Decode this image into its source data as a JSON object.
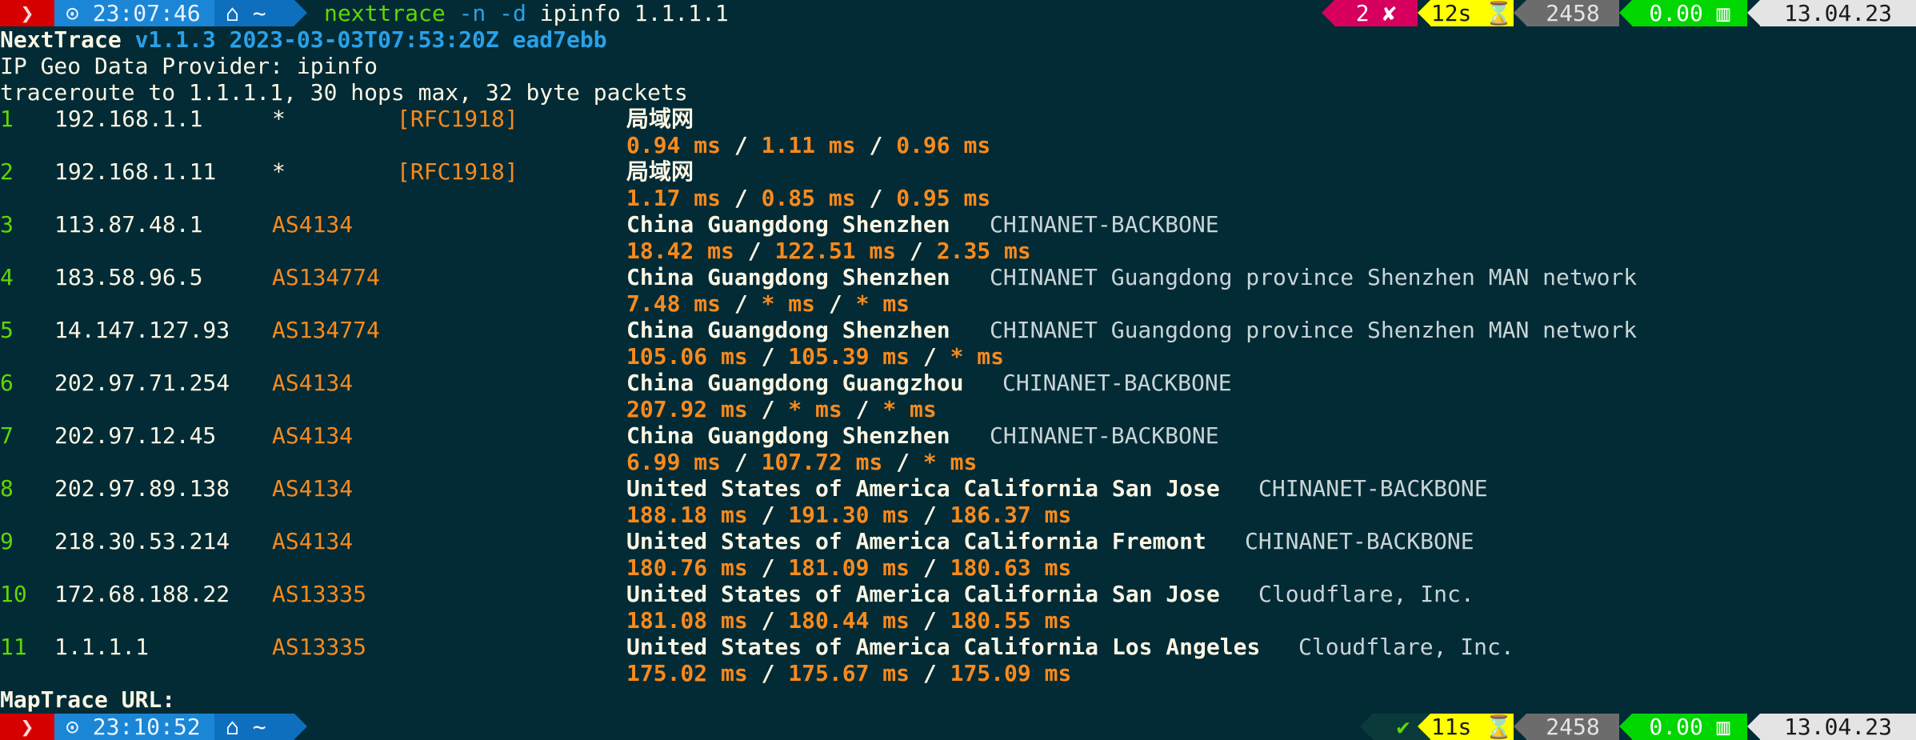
{
  "top_prompt": {
    "os_glyph": "❯",
    "time": "⊙ 23:07:46",
    "dir": "⌂ ~",
    "command": "nexttrace",
    "flags": "-n -d",
    "args": "ipinfo 1.1.1.1",
    "status": "2 ✘",
    "duration": "12s ⌛",
    "history": "2458",
    "load": "0.00 ▥",
    "date": "13.04.23"
  },
  "output": {
    "app_name": "NextTrace",
    "version_info": "v1.1.3 2023-03-03T07:53:20Z ead7ebb",
    "provider_line": "IP Geo Data Provider: ipinfo",
    "trace_line": "traceroute to 1.1.1.1, 30 hops max, 32 byte packets",
    "hops": [
      {
        "n": "1",
        "ip": "192.168.1.1",
        "asn": "*",
        "tag": "[RFC1918]",
        "geo": "局域网",
        "owner": "",
        "rtt1": "0.94 ms",
        "rtt2": "1.11 ms",
        "rtt3": "0.96 ms"
      },
      {
        "n": "2",
        "ip": "192.168.1.11",
        "asn": "*",
        "tag": "[RFC1918]",
        "geo": "局域网",
        "owner": "",
        "rtt1": "1.17 ms",
        "rtt2": "0.85 ms",
        "rtt3": "0.95 ms"
      },
      {
        "n": "3",
        "ip": "113.87.48.1",
        "asn": "AS4134",
        "tag": "",
        "geo": "China Guangdong Shenzhen",
        "owner": "CHINANET-BACKBONE",
        "rtt1": "18.42 ms",
        "rtt2": "122.51 ms",
        "rtt3": "2.35 ms"
      },
      {
        "n": "4",
        "ip": "183.58.96.5",
        "asn": "AS134774",
        "tag": "",
        "geo": "China Guangdong Shenzhen",
        "owner": "CHINANET Guangdong province Shenzhen MAN network",
        "rtt1": "7.48 ms",
        "rtt2": "* ms",
        "rtt3": "* ms"
      },
      {
        "n": "5",
        "ip": "14.147.127.93",
        "asn": "AS134774",
        "tag": "",
        "geo": "China Guangdong Shenzhen",
        "owner": "CHINANET Guangdong province Shenzhen MAN network",
        "rtt1": "105.06 ms",
        "rtt2": "105.39 ms",
        "rtt3": "* ms"
      },
      {
        "n": "6",
        "ip": "202.97.71.254",
        "asn": "AS4134",
        "tag": "",
        "geo": "China Guangdong Guangzhou",
        "owner": "CHINANET-BACKBONE",
        "rtt1": "207.92 ms",
        "rtt2": "* ms",
        "rtt3": "* ms"
      },
      {
        "n": "7",
        "ip": "202.97.12.45",
        "asn": "AS4134",
        "tag": "",
        "geo": "China Guangdong Shenzhen",
        "owner": "CHINANET-BACKBONE",
        "rtt1": "6.99 ms",
        "rtt2": "107.72 ms",
        "rtt3": "* ms"
      },
      {
        "n": "8",
        "ip": "202.97.89.138",
        "asn": "AS4134",
        "tag": "",
        "geo": "United States of America California San Jose",
        "owner": "CHINANET-BACKBONE",
        "rtt1": "188.18 ms",
        "rtt2": "191.30 ms",
        "rtt3": "186.37 ms"
      },
      {
        "n": "9",
        "ip": "218.30.53.214",
        "asn": "AS4134",
        "tag": "",
        "geo": "United States of America California Fremont",
        "owner": "CHINANET-BACKBONE",
        "rtt1": "180.76 ms",
        "rtt2": "181.09 ms",
        "rtt3": "180.63 ms"
      },
      {
        "n": "10",
        "ip": "172.68.188.22",
        "asn": "AS13335",
        "tag": "",
        "geo": "United States of America California San Jose",
        "owner": "Cloudflare, Inc.",
        "rtt1": "181.08 ms",
        "rtt2": "180.44 ms",
        "rtt3": "180.55 ms"
      },
      {
        "n": "11",
        "ip": "1.1.1.1",
        "asn": "AS13335",
        "tag": "",
        "geo": "United States of America California Los Angeles",
        "owner": "Cloudflare, Inc.",
        "rtt1": "175.02 ms",
        "rtt2": "175.67 ms",
        "rtt3": "175.09 ms"
      }
    ],
    "rtt_separator": "/",
    "maptrace_label": "MapTrace URL:"
  },
  "bottom_prompt": {
    "os_glyph": "❯",
    "time": "⊙ 23:10:52",
    "dir": "⌂ ~",
    "status": "✔",
    "duration": "11s ⌛",
    "history": "2458",
    "load": "0.00 ▥",
    "date": "13.04.23"
  },
  "colors": {
    "background": "#022b36",
    "text": "#fdf6e3",
    "green": "#5fd700",
    "orange": "#f88a1c",
    "blue": "#2aa1e8"
  }
}
